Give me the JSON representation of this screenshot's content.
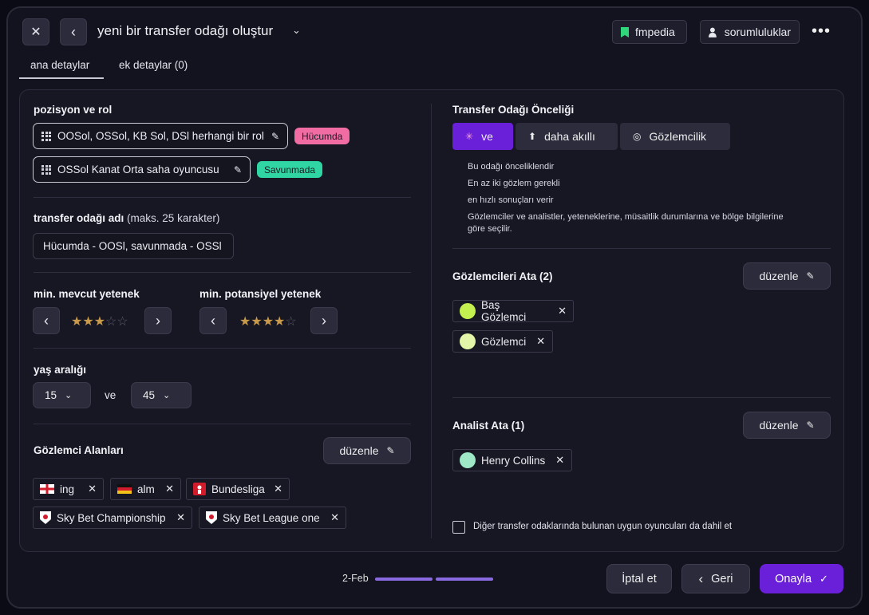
{
  "header": {
    "title": "yeni bir transfer odağı oluştur",
    "fmpedia_label": "fmpedia",
    "responsibilities_label": "sorumluluklar"
  },
  "tabs": [
    {
      "label": "ana detaylar",
      "active": true
    },
    {
      "label": "ek detaylar (0)",
      "active": false
    }
  ],
  "left": {
    "position_label": "pozisyon ve rol",
    "roles": [
      {
        "text": "OOSol, OSSol, KB Sol, DSl herhangi bir rol",
        "badge": "Hücumda",
        "badge_color": "#f06ca2"
      },
      {
        "text": "OSSol  Kanat Orta saha oyuncusu",
        "badge": "Savunmada",
        "badge_color": "#2fd6a4"
      }
    ],
    "name_label": "transfer odağı adı",
    "name_hint": "(maks. 25 karakter)",
    "name_value": "Hücumda - OOSl, savunmada - OSSl",
    "min_current_label": "min. mevcut yetenek",
    "min_current_stars": 3,
    "min_potential_label": "min. potansiyel yetenek",
    "min_potential_stars": 4,
    "stars_max": 5,
    "age_label": "yaş aralığı",
    "age_from": "15",
    "age_and": "ve",
    "age_to": "45",
    "scout_areas_label": "Gözlemci Alanları",
    "edit_label": "düzenle",
    "areas": [
      {
        "label": "ing",
        "icon": "england-flag-icon"
      },
      {
        "label": "alm",
        "icon": "germany-flag-icon"
      },
      {
        "label": "Bundesliga",
        "icon": "bundesliga-logo-icon"
      },
      {
        "label": "Sky Bet Championship",
        "icon": "efl-logo-icon"
      },
      {
        "label": "Sky Bet League one",
        "icon": "efl-logo-icon"
      }
    ]
  },
  "right": {
    "priority_label": "Transfer Odağı Önceliği",
    "priority_options": [
      {
        "label": "ve",
        "active": true
      },
      {
        "label": "daha akıllı",
        "active": false
      },
      {
        "label": "Gözlemcilik",
        "active": false
      }
    ],
    "notes": [
      "Bu odağı önceliklendir",
      "En az iki gözlem gerekli",
      "en hızlı sonuçları verir",
      "Gözlemciler ve analistler, yeteneklerine, müsaitlik durumlarına ve bölge bilgilerine",
      "göre seçilir."
    ],
    "assign_scouts_label": "Gözlemcileri Ata (2)",
    "scouts": [
      {
        "name": "Baş Gözlemci",
        "color": "#c4f050"
      },
      {
        "name": "Gözlemci",
        "color": "#e2f5a8"
      }
    ],
    "assign_analyst_label": "Analist Ata (1)",
    "analysts": [
      {
        "name": "Henry Collins",
        "color": "#9ee8c8"
      }
    ],
    "edit_label": "düzenle",
    "include_label": "Diğer transfer odaklarında bulunan uygun oyuncuları da dahil et",
    "include_checked": false
  },
  "footer": {
    "step_label": "2-Feb",
    "cancel_label": "İptal et",
    "back_label": "Geri",
    "confirm_label": "Onayla"
  },
  "colors": {
    "accent": "#6a1fd8",
    "panel": "#171724",
    "background": "#13131f"
  }
}
